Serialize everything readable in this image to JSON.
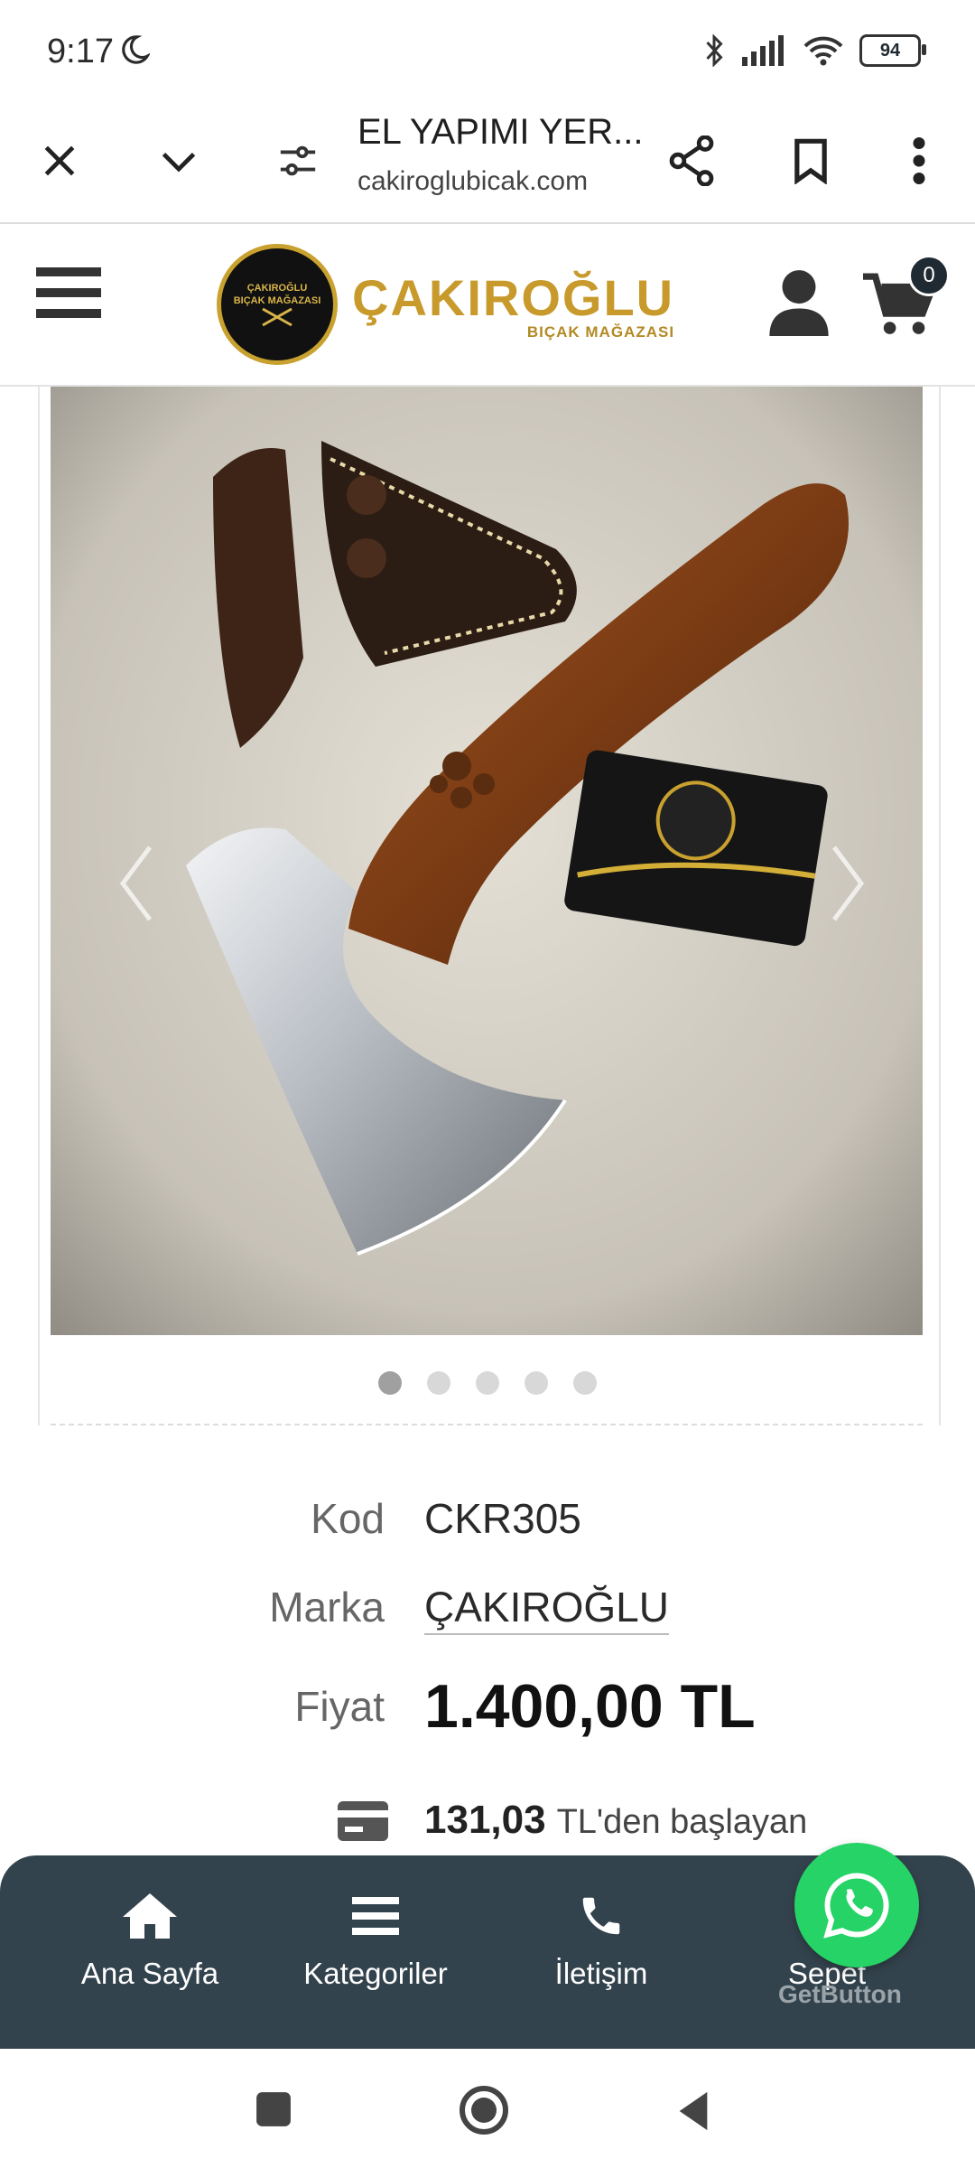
{
  "status_bar": {
    "time": "9:17",
    "battery": "94"
  },
  "browser": {
    "title": "EL YAPIMI YER...",
    "url": "cakiroglubicak.com"
  },
  "brand": {
    "emblem_line1": "ÇAKIROĞLU",
    "emblem_line2": "BIÇAK MAĞAZASI",
    "name": "ÇAKIROĞLU",
    "sub": "BIÇAK MAĞAZASI"
  },
  "cart": {
    "count": "0"
  },
  "gallery": {
    "slides": 5,
    "active_index": 0
  },
  "product": {
    "code_label": "Kod",
    "code_value": "CKR305",
    "brand_label": "Marka",
    "brand_value": "ÇAKIROĞLU",
    "price_label": "Fiyat",
    "price_value": "1.400,00 TL",
    "installment_amount": "131,03",
    "installment_text": "TL'den başlayan"
  },
  "bottom_nav": {
    "home": "Ana Sayfa",
    "categories": "Kategoriler",
    "contact": "İletişim",
    "cart": "Sepet"
  },
  "getbutton": "GetButton",
  "colors": {
    "bottom_nav_bg": "#33434d",
    "whatsapp": "#25d366",
    "brand_gold": "#c79a2b"
  }
}
